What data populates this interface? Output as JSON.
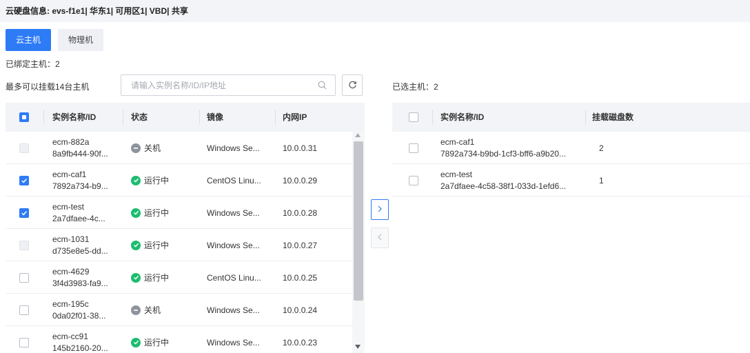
{
  "info_bar": {
    "text": "云硬盘信息: evs-f1e1| 华东1| 可用区1| VBD| 共享"
  },
  "host_type_tabs": [
    {
      "label": "云主机",
      "active": true
    },
    {
      "label": "物理机",
      "active": false
    }
  ],
  "bound_hosts": {
    "label": "已绑定主机：2"
  },
  "max_hint": {
    "label": "最多可以挂载14台主机"
  },
  "search": {
    "placeholder": "请输入实例名称/ID/IP地址",
    "value": ""
  },
  "selected_hosts": {
    "label": "已选主机：2"
  },
  "left_table": {
    "header_checkbox": "indeterminate",
    "columns": [
      "实例名称/ID",
      "状态",
      "镜像",
      "内网IP"
    ],
    "rows": [
      {
        "name": "ecm-882a",
        "id": "8a9fb444-90f...",
        "status": "关机",
        "status_type": "off",
        "image": "Windows Se...",
        "ip": "10.0.0.31",
        "checkbox": "disabled"
      },
      {
        "name": "ecm-caf1",
        "id": "7892a734-b9...",
        "status": "运行中",
        "status_type": "on",
        "image": "CentOS Linu...",
        "ip": "10.0.0.29",
        "checkbox": "checked"
      },
      {
        "name": "ecm-test",
        "id": "2a7dfaee-4c...",
        "status": "运行中",
        "status_type": "on",
        "image": "Windows Se...",
        "ip": "10.0.0.28",
        "checkbox": "checked"
      },
      {
        "name": "ecm-1031",
        "id": "d735e8e5-dd...",
        "status": "运行中",
        "status_type": "on",
        "image": "Windows Se...",
        "ip": "10.0.0.27",
        "checkbox": "disabled"
      },
      {
        "name": "ecm-4629",
        "id": "3f4d3983-fa9...",
        "status": "运行中",
        "status_type": "on",
        "image": "CentOS Linu...",
        "ip": "10.0.0.25",
        "checkbox": "unchecked"
      },
      {
        "name": "ecm-195c",
        "id": "0da02f01-38...",
        "status": "关机",
        "status_type": "off",
        "image": "Windows Se...",
        "ip": "10.0.0.24",
        "checkbox": "unchecked"
      },
      {
        "name": "ecm-cc91",
        "id": "145b2160-20...",
        "status": "运行中",
        "status_type": "on",
        "image": "Windows Se...",
        "ip": "10.0.0.23",
        "checkbox": "unchecked"
      }
    ]
  },
  "right_table": {
    "columns": [
      "实例名称/ID",
      "挂载磁盘数"
    ],
    "rows": [
      {
        "name": "ecm-caf1",
        "id": "7892a734-b9bd-1cf3-bff6-a9b20...",
        "disks": "2"
      },
      {
        "name": "ecm-test",
        "id": "2a7dfaee-4c58-38f1-033d-1efd6...",
        "disks": "1"
      }
    ]
  },
  "colors": {
    "accent": "#2e7bf6",
    "running": "#1bbd6f",
    "stopped": "#8e939c"
  }
}
